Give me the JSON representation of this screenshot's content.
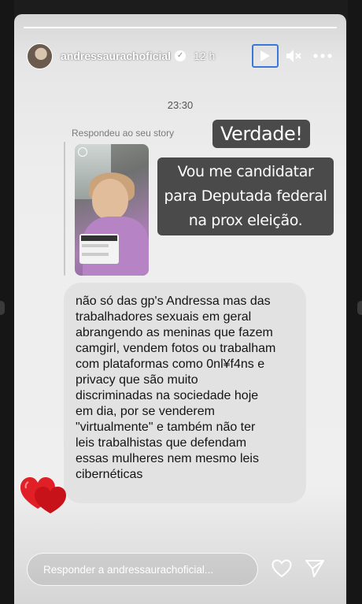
{
  "header": {
    "username": "andressaurachoficial",
    "time_ago": "12 h"
  },
  "dm": {
    "timestamp": "23:30",
    "replied_label": "Respondeu ao seu story",
    "message": "não só das gp's Andressa mas das\ntrabalhadores sexuais em geral\nabrangendo as meninas que fazem\ncamgirl, vendem fotos ou trabalham\ncom plataformas como 0nl¥f4ns e\nprivacy que são muito\ndiscriminadas na sociedade hoje\nem dia, por se venderem\n\"virtualmente\" e também não ter\nleis trabalhistas que defendam\nessas mulheres nem mesmo leis\ncibernéticas"
  },
  "stickers": {
    "verdade": "Verdade!",
    "candidatar": "Vou me candidatar para Deputada federal na prox eleição."
  },
  "footer": {
    "reply_placeholder": "Responder a andressaurachoficial..."
  },
  "icons": {
    "play": "play-icon",
    "mute": "muted-speaker-icon",
    "more": "more-options-icon",
    "like": "heart-outline-icon",
    "send": "paper-plane-icon",
    "verified": "verified-badge-icon",
    "sticker": "red-hearts-sticker"
  },
  "colors": {
    "highlight_border": "#3a78d8",
    "sticker_bg": "#4a4a4a",
    "message_bubble": "#e2e2e2",
    "hearts": "#e01f26"
  }
}
